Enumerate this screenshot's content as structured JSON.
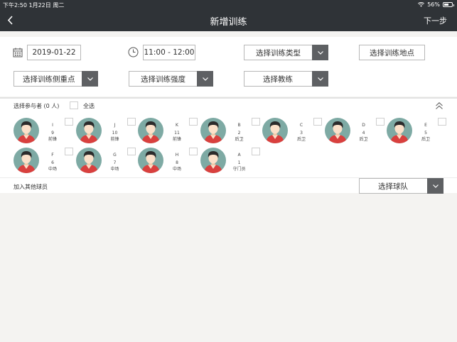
{
  "status_bar": {
    "time_date": "下午2:50   1月22日 周二",
    "battery_text": "56%",
    "battery_level": 0.56
  },
  "nav": {
    "title": "新增训练",
    "next_label": "下一步"
  },
  "form": {
    "date": "2019-01-22",
    "time": "11:00 - 12:00",
    "training_type": "选择训练类型",
    "location": "选择训练地点",
    "focus": "选择训练侧重点",
    "intensity": "选择训练强度",
    "coach": "选择教练"
  },
  "participants": {
    "header": "选择参与者 (0 人)",
    "select_all": "全选",
    "players": [
      {
        "name": "I",
        "number": "9",
        "position": "前锋"
      },
      {
        "name": "J",
        "number": "10",
        "position": "前锋"
      },
      {
        "name": "K",
        "number": "11",
        "position": "前锋"
      },
      {
        "name": "B",
        "number": "2",
        "position": "后卫"
      },
      {
        "name": "C",
        "number": "3",
        "position": "后卫"
      },
      {
        "name": "D",
        "number": "4",
        "position": "后卫"
      },
      {
        "name": "E",
        "number": "5",
        "position": "后卫"
      },
      {
        "name": "F",
        "number": "6",
        "position": "中场"
      },
      {
        "name": "G",
        "number": "7",
        "position": "中场"
      },
      {
        "name": "H",
        "number": "8",
        "position": "中场"
      },
      {
        "name": "A",
        "number": "1",
        "position": "守门员"
      }
    ]
  },
  "add_players": {
    "label": "加入其他球员",
    "team_select": "选择球队"
  },
  "colors": {
    "nav_bg": "#2f3337",
    "avatar_bg": "#7eaaa4",
    "jersey": "#d9403e",
    "dropdown_btn": "#5e6063"
  }
}
